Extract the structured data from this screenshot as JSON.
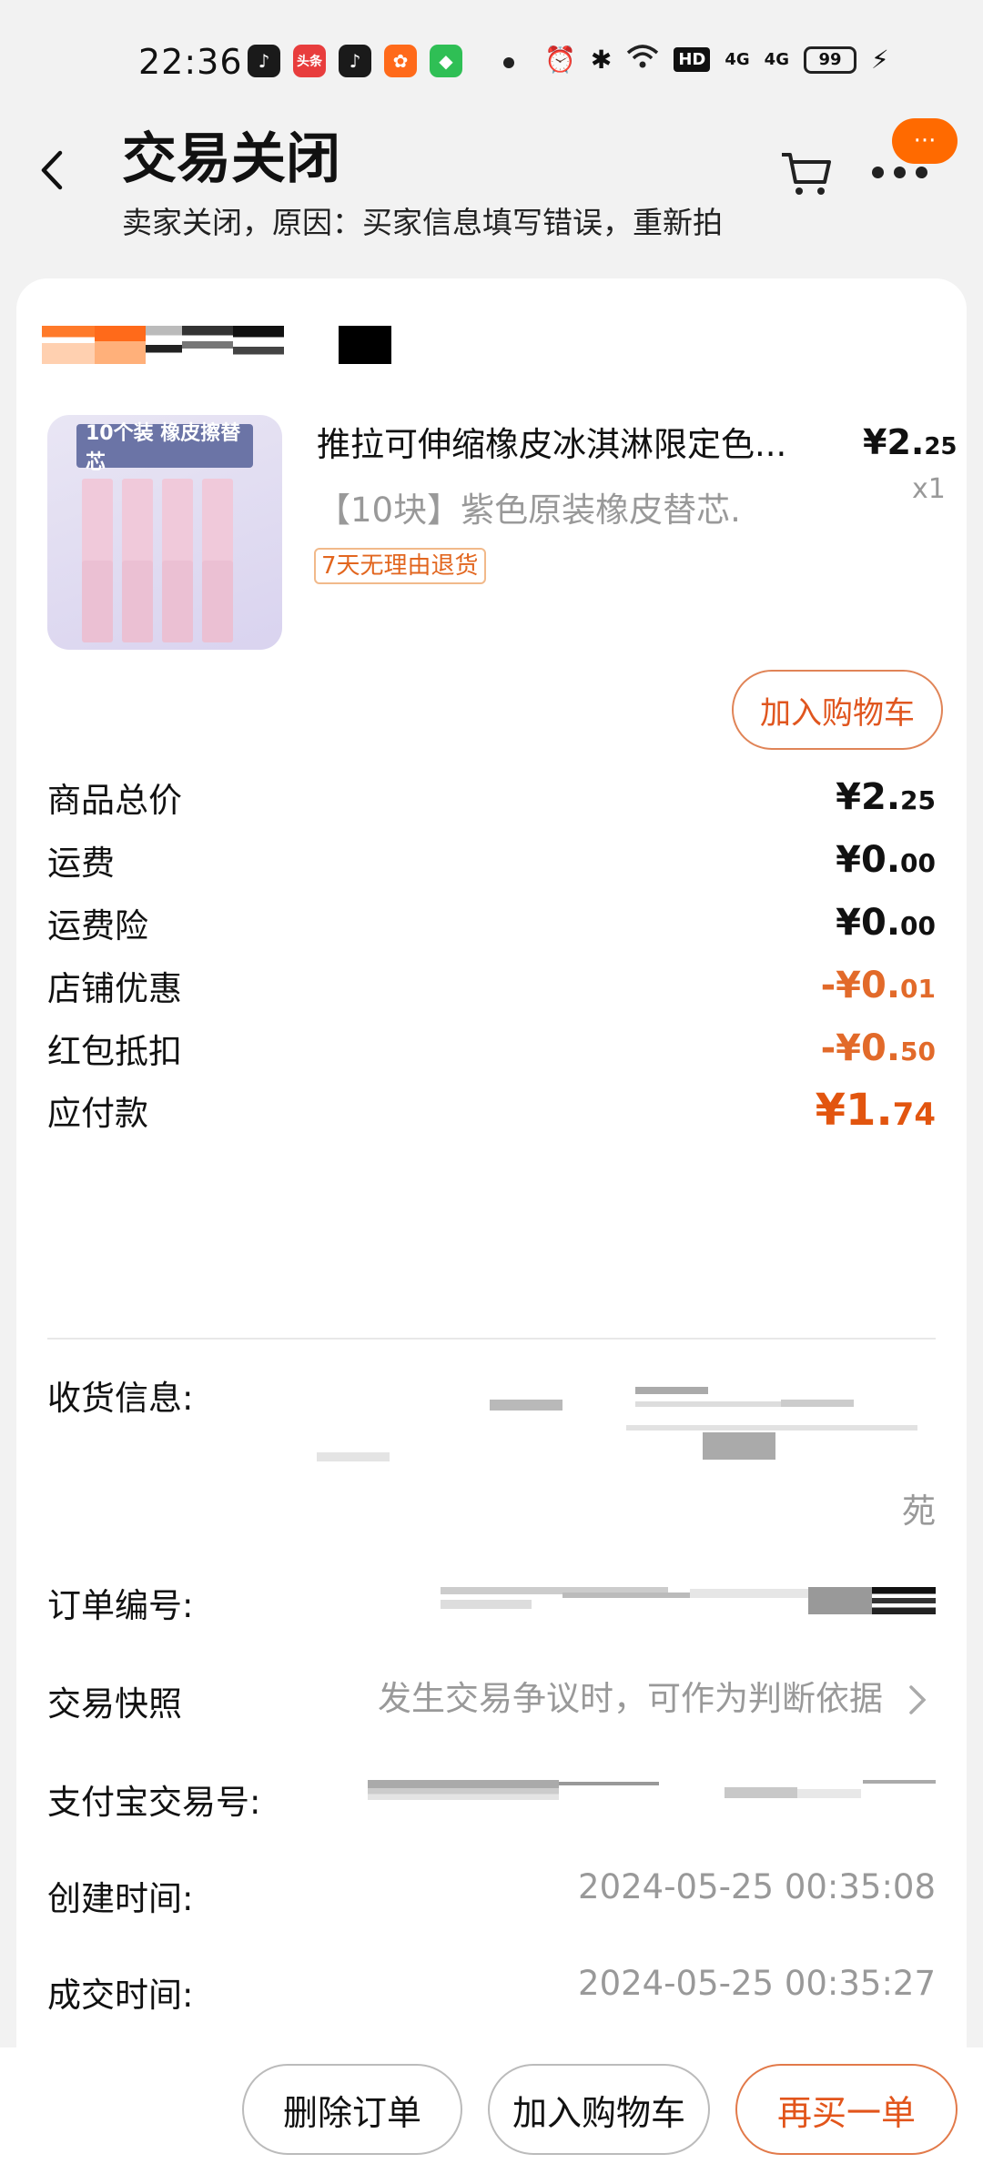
{
  "status_bar": {
    "time": "22:36",
    "battery": "99",
    "network": "4G",
    "hd_label": "HD"
  },
  "app_icons": [
    {
      "name": "douyin-icon",
      "label": "♪",
      "color": "#1a1a1a"
    },
    {
      "name": "toutiao-icon",
      "label": "头条",
      "color": "#e83d3d"
    },
    {
      "name": "douyin-lite-icon",
      "label": "♪",
      "color": "#1a1a1a"
    },
    {
      "name": "kuaishou-icon",
      "label": "✿",
      "color": "#ff6a1a"
    },
    {
      "name": "android-store-icon",
      "label": "◆",
      "color": "#2fbf55"
    }
  ],
  "header": {
    "title": "交易关闭",
    "subtitle": "卖家关闭，原因：买家信息填写错误，重新拍",
    "more_badge": "···"
  },
  "product": {
    "image_badge": "10个装 橡皮擦替芯",
    "title": "推拉可伸缩橡皮冰淇淋限定色...",
    "sku": "【10块】紫色原装橡皮替芯.",
    "price_int": "¥2.",
    "price_dec": "25",
    "qty": "x1",
    "return_tag": "7天无理由退货",
    "add_cart_label": "加入购物车"
  },
  "price_rows": [
    {
      "label": "商品总价",
      "int": "¥2.",
      "dec": "25",
      "style": "normal"
    },
    {
      "label": "运费",
      "int": "¥0.",
      "dec": "00",
      "style": "normal"
    },
    {
      "label": "运费险",
      "int": "¥0.",
      "dec": "00",
      "style": "normal"
    },
    {
      "label": "店铺优惠",
      "int": "-¥0.",
      "dec": "01",
      "style": "neg"
    },
    {
      "label": "红包抵扣",
      "int": "-¥0.",
      "dec": "50",
      "style": "neg"
    },
    {
      "label": "应付款",
      "int": "¥1.",
      "dec": "74",
      "style": "pay"
    }
  ],
  "order_info": {
    "shipping_label": "收货信息:",
    "shipping_tail": "苑",
    "order_no_label": "订单编号:",
    "snapshot_label": "交易快照",
    "snapshot_value": "发生交易争议时，可作为判断依据",
    "alipay_label": "支付宝交易号:",
    "created_label": "创建时间:",
    "created_value": "2024-05-25 00:35:08",
    "deal_label": "成交时间:",
    "deal_value": "2024-05-25 00:35:27"
  },
  "bottom_bar": {
    "delete_label": "删除订单",
    "add_cart_label": "加入购物车",
    "rebuy_label": "再买一单"
  },
  "colors": {
    "accent": "#e2550f",
    "discount": "#e26a2a",
    "badge": "#ff6a00"
  }
}
